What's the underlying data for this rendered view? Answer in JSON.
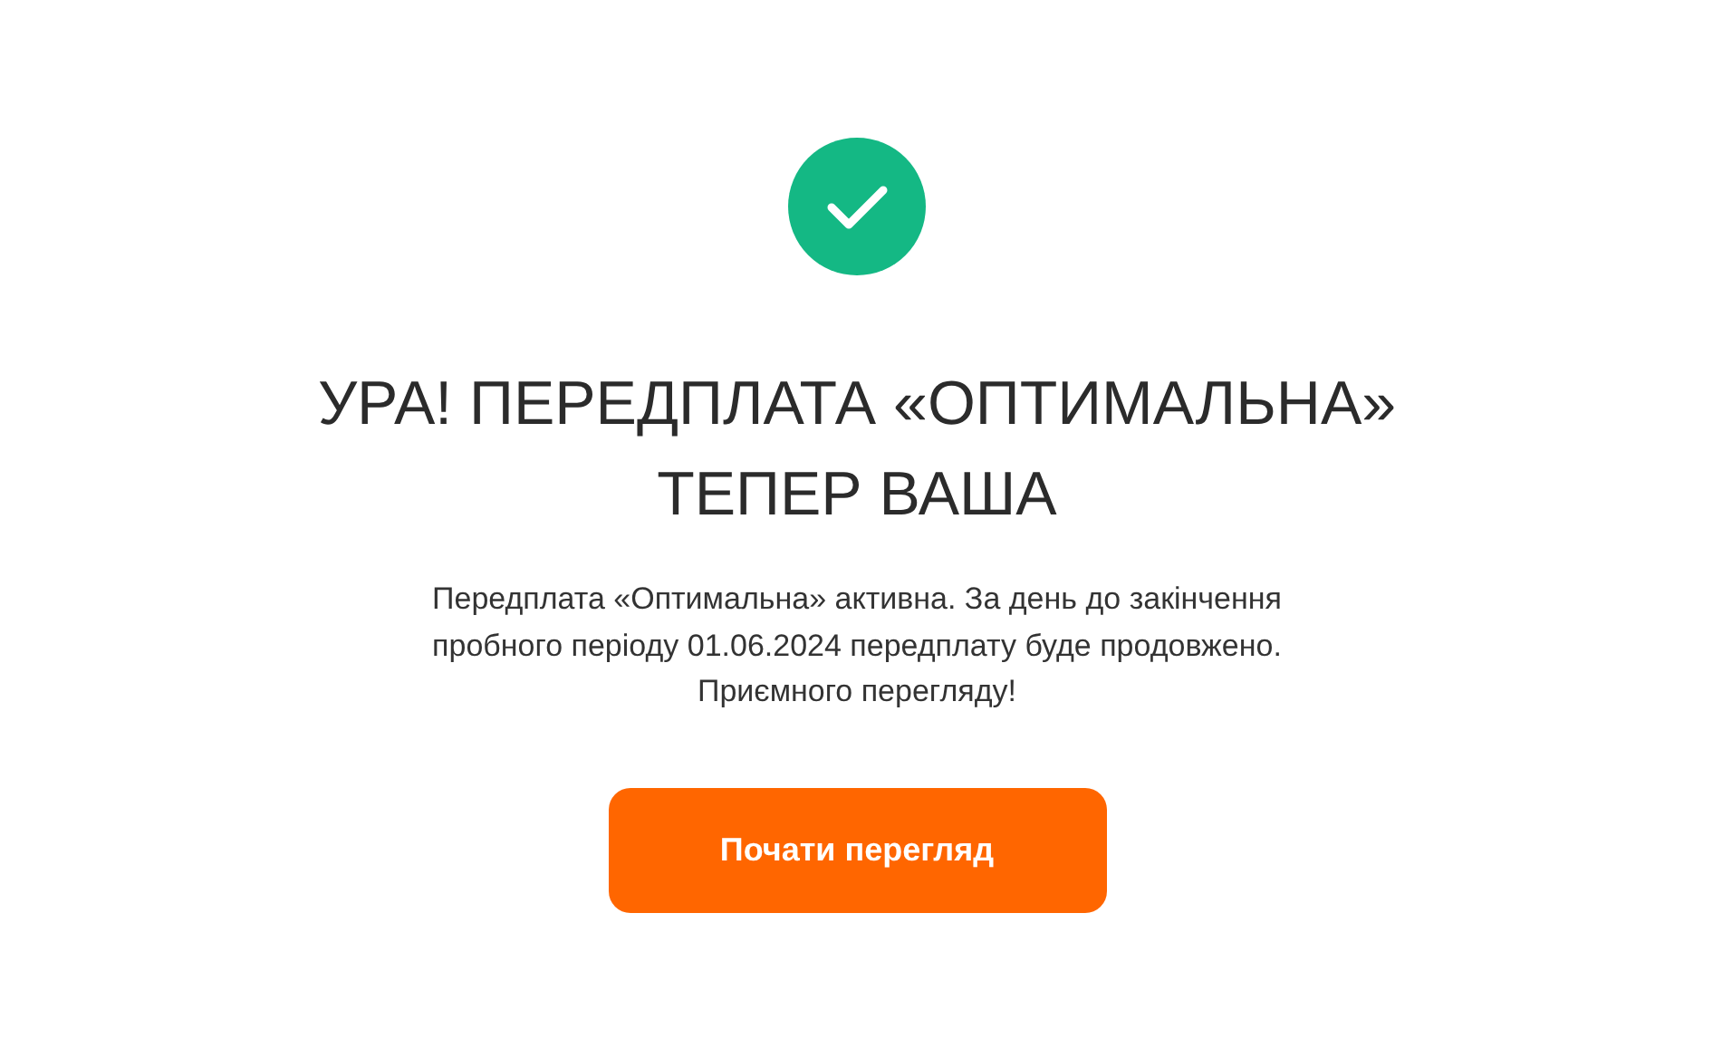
{
  "title": "УРА! ПЕРЕДПЛАТА «ОПТИМАЛЬНА»\nТЕПЕР ВАША",
  "message": "Передплата «Оптимальна» активна. За день до закінчення\nпробного періоду 01.06.2024 передплату буде продовжено.\nПриємного перегляду!",
  "button": {
    "label": "Почати перегляд"
  }
}
